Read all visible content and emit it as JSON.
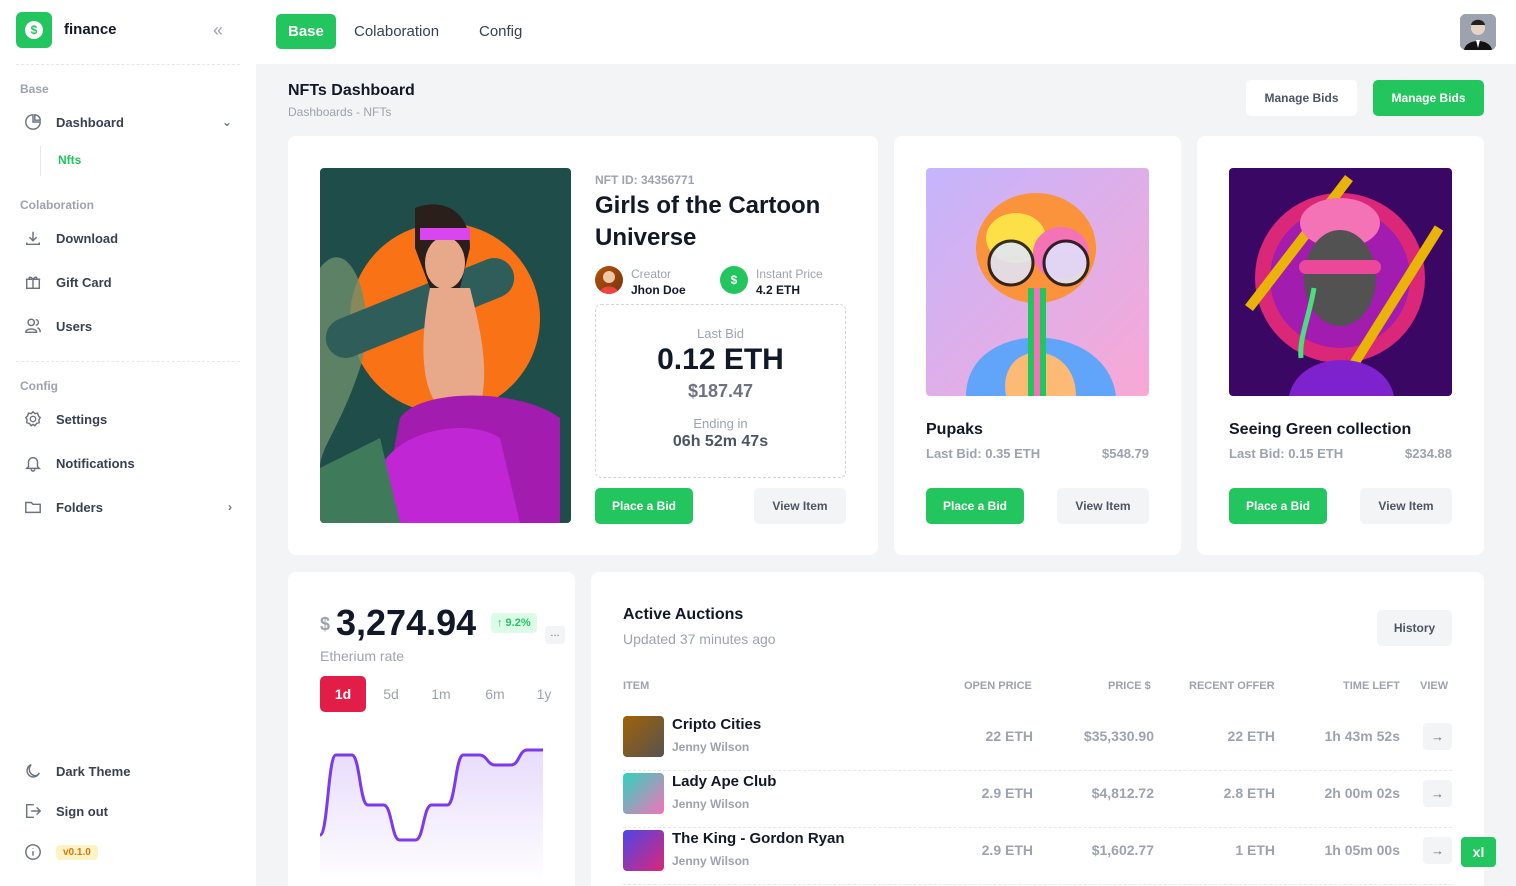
{
  "app": {
    "brand": "finance",
    "logo_glyph": "$"
  },
  "sidebar": {
    "sections": {
      "base": "Base",
      "colaboration": "Colaboration",
      "config": "Config"
    },
    "items": {
      "dashboard": "Dashboard",
      "nfts": "Nfts",
      "download": "Download",
      "gift_card": "Gift Card",
      "users": "Users",
      "settings": "Settings",
      "notifications": "Notifications",
      "folders": "Folders",
      "dark_theme": "Dark Theme",
      "sign_out": "Sign out"
    },
    "version": "v0.1.0"
  },
  "topbar": {
    "tabs": [
      "Base",
      "Colaboration",
      "Config"
    ],
    "active_tab": "Base"
  },
  "page": {
    "title": "NFTs Dashboard",
    "breadcrumb": "Dashboards  -  NFTs",
    "manage_bids_light": "Manage Bids",
    "manage_bids_green": "Manage Bids"
  },
  "featured": {
    "nft_id": "NFT ID: 34356771",
    "title": "Girls of the Cartoon Universe",
    "creator_label": "Creator",
    "creator_name": "Jhon Doe",
    "price_label": "Instant Price",
    "price_value": "4.2 ETH",
    "price_icon": "$",
    "last_bid_label": "Last Bid",
    "last_bid_eth": "0.12 ETH",
    "last_bid_usd": "$187.47",
    "ending_label": "Ending in",
    "ending_value": "06h 52m 47s",
    "place_bid": "Place a Bid",
    "view_item": "View Item"
  },
  "cards": [
    {
      "title": "Pupaks",
      "last_bid": "Last Bid: 0.35 ETH",
      "usd": "$548.79",
      "place_bid": "Place a Bid",
      "view_item": "View Item"
    },
    {
      "title": "Seeing Green collection",
      "last_bid": "Last Bid: 0.15 ETH",
      "usd": "$234.88",
      "place_bid": "Place a Bid",
      "view_item": "View Item"
    }
  ],
  "rate": {
    "currency": "$",
    "value": "3,274.94",
    "change": "↑ 9.2%",
    "more": "...",
    "label": "Etherium rate",
    "periods": [
      "1d",
      "5d",
      "1m",
      "6m",
      "1y"
    ],
    "active_period": "1d",
    "line_color": "#7c3aed"
  },
  "chart_data": {
    "type": "line",
    "values": [
      0.15,
      0.95,
      0.95,
      0.45,
      0.45,
      0.1,
      0.1,
      0.45,
      0.45,
      0.95,
      0.95,
      0.85,
      0.85,
      1.0,
      1.0
    ]
  },
  "auctions": {
    "title": "Active Auctions",
    "subtitle": "Updated 37 minutes ago",
    "history_button": "History",
    "columns": [
      "ITEM",
      "OPEN PRICE",
      "PRICE $",
      "RECENT OFFER",
      "TIME LEFT",
      "VIEW"
    ],
    "rows": [
      {
        "name": "Cripto Cities",
        "owner": "Jenny Wilson",
        "open_price": "22 ETH",
        "price_usd": "$35,330.90",
        "recent_offer": "22 ETH",
        "time_left": "1h 43m 52s",
        "arrow": "→"
      },
      {
        "name": "Lady Ape Club",
        "owner": "Jenny Wilson",
        "open_price": "2.9 ETH",
        "price_usd": "$4,812.72",
        "recent_offer": "2.8 ETH",
        "time_left": "2h 00m 02s",
        "arrow": "→"
      },
      {
        "name": "The King - Gordon Ryan",
        "owner": "Jenny Wilson",
        "open_price": "2.9 ETH",
        "price_usd": "$1,602.77",
        "recent_offer": "1 ETH",
        "time_left": "1h 05m 00s",
        "arrow": "→"
      }
    ]
  },
  "breakpoint_badge": "xl",
  "colors": {
    "accent": "#22c55e",
    "danger": "#e11d48",
    "text": "#111827",
    "muted": "#9ca3af"
  }
}
